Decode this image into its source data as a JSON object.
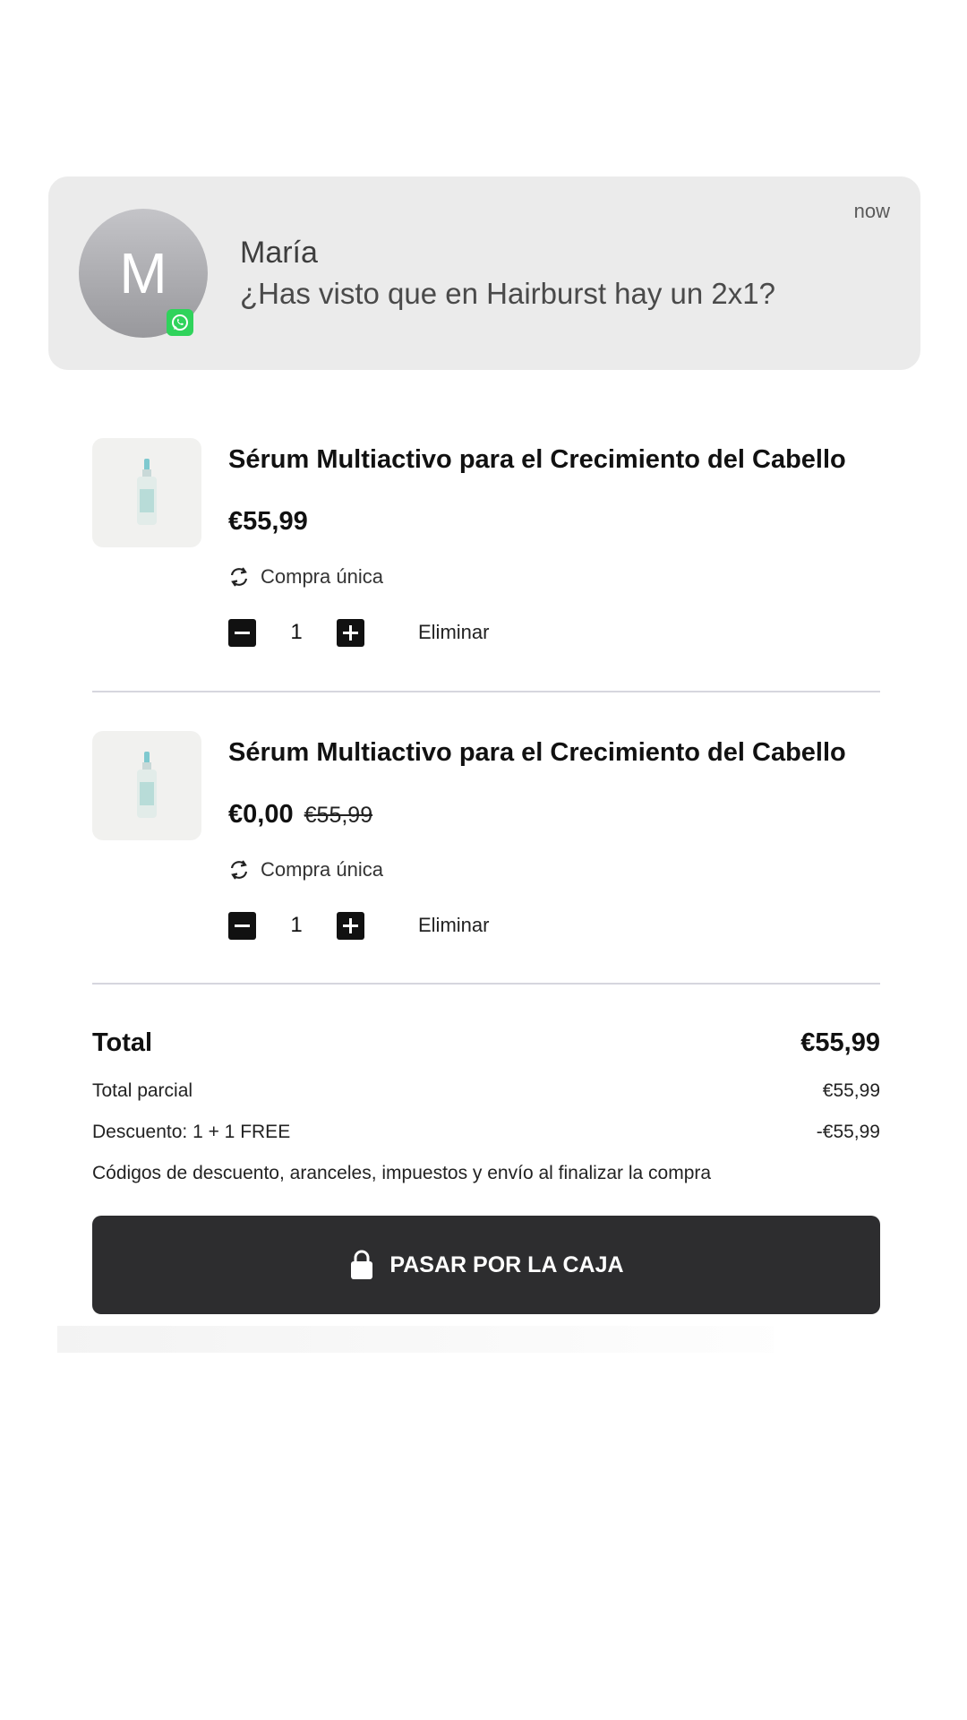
{
  "notification": {
    "avatar_letter": "M",
    "sender": "María",
    "message": "¿Has visto que en Hairburst hay un 2x1?",
    "time": "now",
    "app_icon": "whatsapp-icon"
  },
  "cart": {
    "items": [
      {
        "title": "Sérum Multiactivo para el Crecimiento del Cabello",
        "price": "€55,99",
        "old_price": "",
        "purchase_type": "Compra única",
        "quantity": "1",
        "remove_label": "Eliminar"
      },
      {
        "title": "Sérum Multiactivo para el Crecimiento del Cabello",
        "price": "€0,00",
        "old_price": "€55,99",
        "purchase_type": "Compra única",
        "quantity": "1",
        "remove_label": "Eliminar"
      }
    ]
  },
  "summary": {
    "total_label": "Total",
    "total_value": "€55,99",
    "subtotal_label": "Total parcial",
    "subtotal_value": "€55,99",
    "discount_label": "Descuento: 1 + 1 FREE",
    "discount_value": "-€55,99",
    "note": "Códigos de descuento, aranceles, impuestos y envío al finalizar la compra"
  },
  "checkout": {
    "label": "PASAR POR LA CAJA",
    "icon": "lock-icon"
  },
  "colors": {
    "notification_bg": "#ebebeb",
    "button_bg": "#2d2d2f",
    "whatsapp_green": "#2fd35b"
  }
}
